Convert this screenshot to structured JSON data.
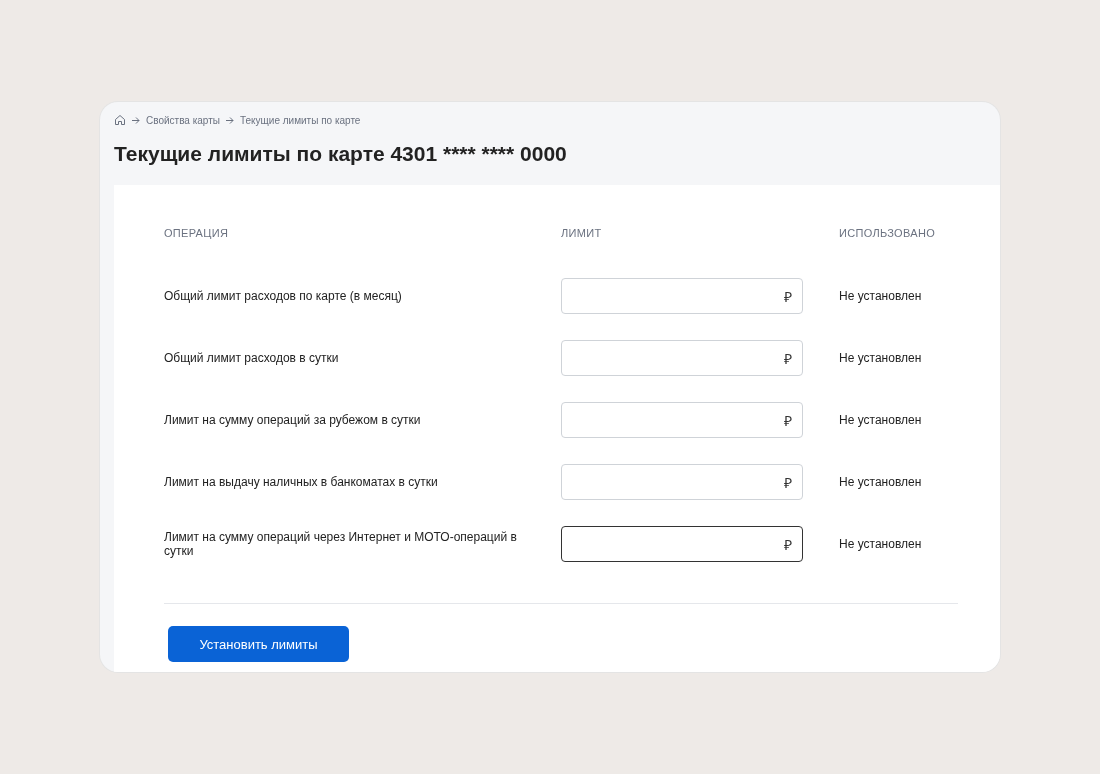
{
  "breadcrumbs": [
    {
      "label": "Свойства карты"
    },
    {
      "label": "Текущие лимиты по карте"
    }
  ],
  "title": "Текущие лимиты по карте 4301 **** **** 0000",
  "table": {
    "columns": [
      "ОПЕРАЦИЯ",
      "ЛИМИТ",
      "ИСПОЛЬЗОВАНО"
    ],
    "rows": [
      {
        "operation": "Общий лимит расходов по карте (в месяц)",
        "currency": "₽",
        "focused": false,
        "used": "Не установлен"
      },
      {
        "operation": "Общий лимит расходов в сутки",
        "currency": "₽",
        "focused": false,
        "used": "Не установлен"
      },
      {
        "operation": "Лимит на сумму операций за рубежом в сутки",
        "currency": "₽",
        "focused": false,
        "used": "Не установлен"
      },
      {
        "operation": "Лимит на выдачу наличных в банкоматах в сутки",
        "currency": "₽",
        "focused": false,
        "used": "Не установлен"
      },
      {
        "operation": "Лимит на сумму операций через Интернет и МОТО-операций в сутки",
        "currency": "₽",
        "focused": true,
        "used": "Не установлен"
      }
    ]
  },
  "submit_button": "Установить лимиты"
}
